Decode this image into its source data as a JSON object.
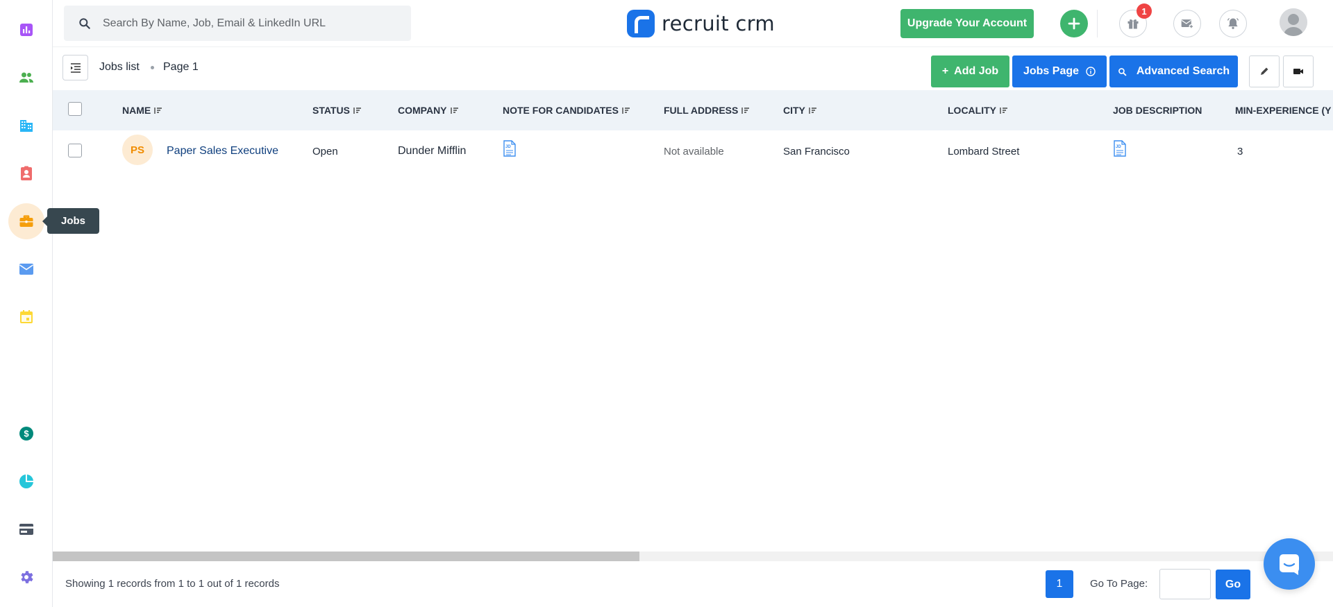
{
  "sidebar": {
    "items": [
      {
        "name": "reports",
        "icon": "bar-chart-icon",
        "color": "#a855f7"
      },
      {
        "name": "candidates",
        "icon": "people-icon",
        "color": "#4caf50"
      },
      {
        "name": "companies",
        "icon": "building-icon",
        "color": "#29b6f6"
      },
      {
        "name": "contacts",
        "icon": "contact-card-icon",
        "color": "#ef6c6c"
      },
      {
        "name": "jobs",
        "icon": "briefcase-icon",
        "color": "#f59e0b",
        "active": true
      },
      {
        "name": "email",
        "icon": "envelope-icon",
        "color": "#5b9bf0"
      },
      {
        "name": "calendar",
        "icon": "calendar-icon",
        "color": "#fdd835"
      },
      {
        "name": "billing",
        "icon": "dollar-icon",
        "color": "#00897b"
      },
      {
        "name": "analytics",
        "icon": "pie-chart-icon",
        "color": "#26c6da"
      },
      {
        "name": "payments",
        "icon": "credit-card-icon",
        "color": "#4b5563"
      },
      {
        "name": "settings",
        "icon": "gear-icon",
        "color": "#7c6fe0"
      }
    ],
    "tooltip": "Jobs"
  },
  "topbar": {
    "search_placeholder": "Search By Name, Job, Email & LinkedIn URL",
    "logo_text": "recruit crm",
    "upgrade_label": "Upgrade Your Account",
    "gift_badge": "1"
  },
  "subheader": {
    "breadcrumb_list": "Jobs list",
    "breadcrumb_page": "Page 1",
    "add_job_label": "Add Job",
    "jobs_page_label": "Jobs Page",
    "advanced_search_label": "Advanced Search"
  },
  "table": {
    "columns": [
      {
        "label": "NAME",
        "sortable": true
      },
      {
        "label": "STATUS",
        "sortable": true
      },
      {
        "label": "COMPANY",
        "sortable": true
      },
      {
        "label": "NOTE FOR CANDIDATES",
        "sortable": true
      },
      {
        "label": "FULL ADDRESS",
        "sortable": true
      },
      {
        "label": "CITY",
        "sortable": true
      },
      {
        "label": "LOCALITY",
        "sortable": true
      },
      {
        "label": "JOB DESCRIPTION",
        "sortable": false
      },
      {
        "label": "MIN-EXPERIENCE (Y",
        "sortable": false
      }
    ],
    "rows": [
      {
        "initials": "PS",
        "name": "Paper Sales Executive",
        "status": "Open",
        "company": "Dunder Mifflin",
        "note_icon": "jd-document-icon",
        "full_address": "Not available",
        "city": "San Francisco",
        "locality": "Lombard Street",
        "job_description_icon": "jd-document-icon",
        "min_experience": "3"
      }
    ]
  },
  "footer": {
    "records_text": "Showing 1 records from 1 to 1 out of 1 records",
    "current_page": "1",
    "goto_label": "Go To Page:",
    "go_label": "Go"
  }
}
